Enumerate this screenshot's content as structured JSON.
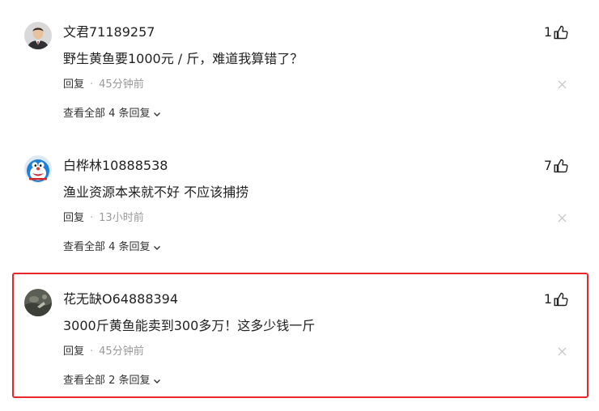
{
  "comments": [
    {
      "username": "文君71189257",
      "likes": "1",
      "text": "野生黄鱼要1000元 / 斤，难道我算错了？",
      "reply_label": "回复",
      "separator": "·",
      "time": "45分钟前",
      "view_all": "查看全部 4 条回复",
      "avatar_icon": "man-in-suit-avatar"
    },
    {
      "username": "白桦林10888538",
      "likes": "7",
      "text": "渔业资源本来就不好 不应该捕捞",
      "reply_label": "回复",
      "separator": "·",
      "time": "13小时前",
      "view_all": "查看全部 4 条回复",
      "avatar_icon": "cartoon-cat-avatar"
    },
    {
      "username": "花无缺O64888394",
      "likes": "1",
      "text": "3000斤黄鱼能卖到300多万！这多少钱一斤",
      "reply_label": "回复",
      "separator": "·",
      "time": "45分钟前",
      "view_all": "查看全部 2 条回复",
      "avatar_icon": "dark-photo-avatar"
    }
  ],
  "colors": {
    "highlight_border": "#e8272b",
    "meta_text": "#999999",
    "primary_text": "#222222"
  }
}
